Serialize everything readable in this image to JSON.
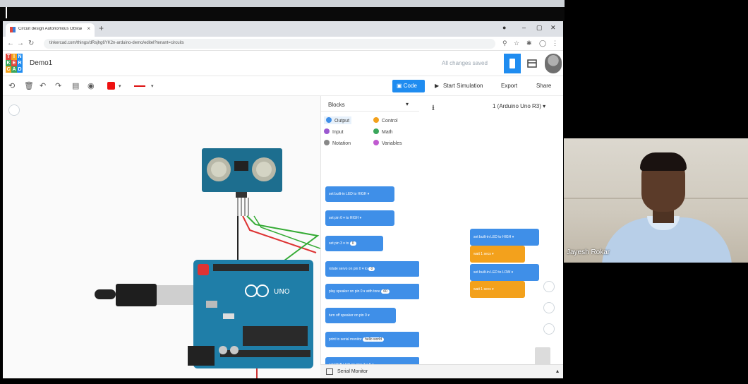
{
  "browser": {
    "tab_title": "Circuit design Autonomous Obstacle...",
    "url": "tinkercad.com/things/dRsjhg6YK2n-arduino-demo/editel?tenant=circuits",
    "new_tab": "+",
    "tab_close": "×"
  },
  "app": {
    "logo_letters": [
      "T",
      "I",
      "N",
      "K",
      "E",
      "R",
      "C",
      "A",
      "D"
    ],
    "logo_colors": [
      "#e2463b",
      "#f3a11c",
      "#1f8cf0",
      "#3aa65b",
      "#e2463b",
      "#1f8cf0",
      "#f3a11c",
      "#3aa65b",
      "#1f8cf0"
    ],
    "project_title": "Demo1",
    "save_status": "All changes saved"
  },
  "toolbar": {
    "code_button": "Code",
    "start_simulation": "Start Simulation",
    "export": "Export",
    "share": "Share"
  },
  "blocks_panel": {
    "title": "Blocks",
    "categories": [
      {
        "label": "Output",
        "color": "#3f8fe8"
      },
      {
        "label": "Control",
        "color": "#f3a11c"
      },
      {
        "label": "Input",
        "color": "#9b59d0"
      },
      {
        "label": "Math",
        "color": "#3aa65b"
      },
      {
        "label": "Notation",
        "color": "#888888"
      },
      {
        "label": "Variables",
        "color": "#c05ad0"
      }
    ],
    "blocks": [
      "set built-in LED to HIGH ▾",
      "set pin 0 ▾ to HIGH ▾",
      "set pin 3 ▾ to",
      "rotate servo on pin 0 ▾ to",
      "play speaker on pin 0 ▾ with tone",
      "turn off speaker on pin 0 ▾",
      "print to serial monitor",
      "set RGB LED on pins 3 ▾ 5 ▾"
    ],
    "pill_values": [
      "0",
      "0",
      "60",
      "hello world"
    ]
  },
  "serial_monitor": {
    "label": "Serial Monitor"
  },
  "code_area": {
    "board": "1 (Arduino Uno R3)",
    "blocks": [
      {
        "text": "set built-in LED to HIGH ▾",
        "kind": "blue"
      },
      {
        "text": "wait 1 secs ▾",
        "kind": "orange",
        "value": "1"
      },
      {
        "text": "set built-in LED to LOW ▾",
        "kind": "blue"
      },
      {
        "text": "wait 1 secs ▾",
        "kind": "orange",
        "value": "1"
      }
    ]
  },
  "webcam": {
    "participant_name": "Jayesh Rokar"
  }
}
